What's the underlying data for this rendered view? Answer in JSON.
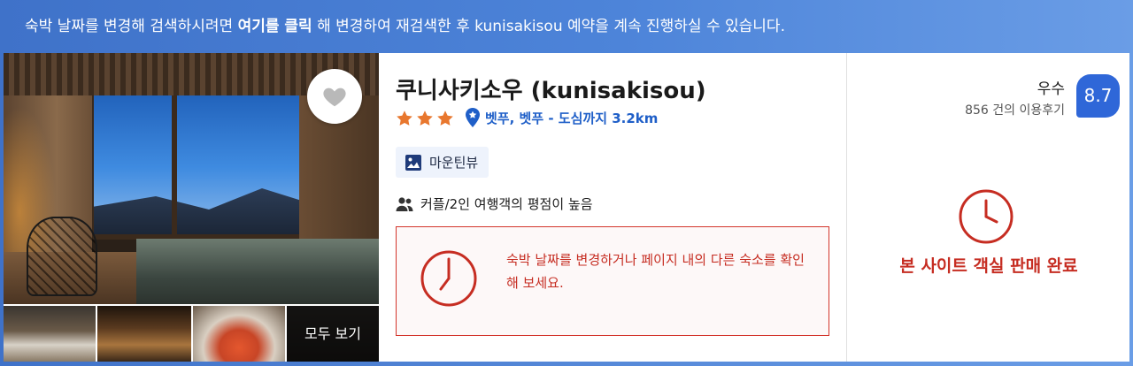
{
  "banner": {
    "prefix": "숙박 날짜를 변경해 검색하시려면 ",
    "link": "여기를 클릭",
    "suffix": " 해 변경하여 재검색한 후 kunisakisou 예약을 계속 진행하실 수 있습니다."
  },
  "hotel": {
    "name": "쿠니사키소우 (kunisakisou)",
    "star_rating": 3,
    "location": "벳푸, 벳푸 - 도심까지 3.2km",
    "mountain_view": "마운틴뷰",
    "traveler_note": "커플/2인 여행객의 평점이 높음"
  },
  "gallery": {
    "see_all": "모두 보기"
  },
  "alert": {
    "message": "숙박 날짜를 변경하거나 페이지 내의 다른 숙소를 확인해 보세요."
  },
  "review": {
    "score_label": "우수",
    "count_text": "856 건의 이용후기",
    "score": "8.7"
  },
  "availability": {
    "soldout_text": "본 사이트 객실 판매 완료"
  },
  "colors": {
    "banner_blue": "#3f72c9",
    "accent_blue": "#2f67d8",
    "alert_red": "#c62d22",
    "star_orange": "#e8772e"
  }
}
